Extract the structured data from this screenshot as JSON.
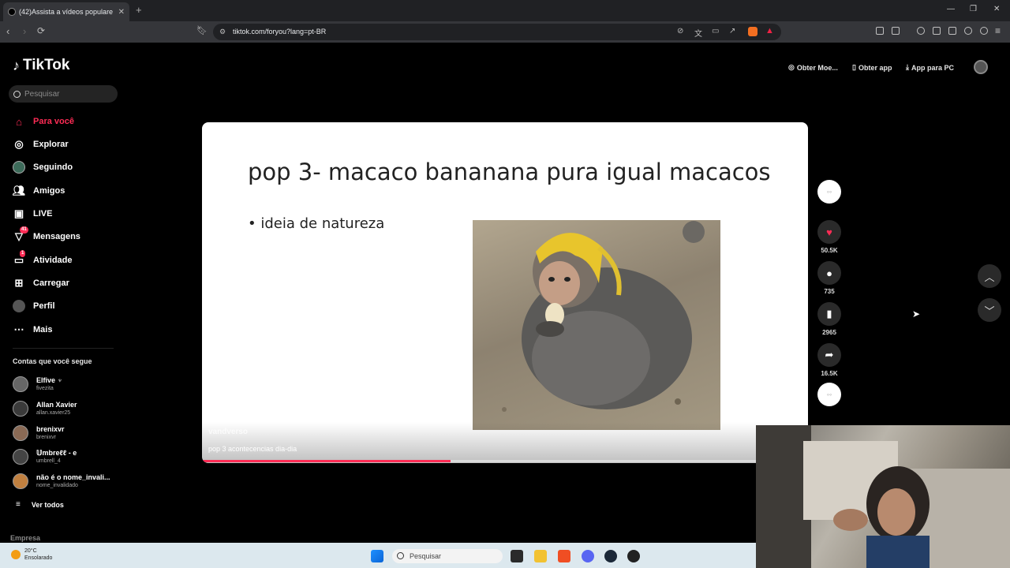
{
  "browser": {
    "tab_title": "(42)Assista a vídeos populare",
    "tab_close": "✕",
    "new_tab": "+",
    "url": "tiktok.com/foryou?lang=pt-BR"
  },
  "sidebar": {
    "logo": "TikTok",
    "search_placeholder": "Pesquisar",
    "items": [
      {
        "label": "Para você",
        "icon": "home-icon"
      },
      {
        "label": "Explorar",
        "icon": "compass-icon"
      },
      {
        "label": "Seguindo",
        "icon": "following-avatar-icon"
      },
      {
        "label": "Amigos",
        "icon": "friends-icon"
      },
      {
        "label": "LIVE",
        "icon": "live-icon"
      },
      {
        "label": "Mensagens",
        "icon": "messages-icon",
        "badge": "41"
      },
      {
        "label": "Atividade",
        "icon": "activity-icon",
        "badge": "1"
      },
      {
        "label": "Carregar",
        "icon": "upload-icon"
      },
      {
        "label": "Perfil",
        "icon": "profile-icon"
      },
      {
        "label": "Mais",
        "icon": "more-icon"
      }
    ],
    "following_title": "Contas que você segue",
    "following": [
      {
        "name": "Elfive ♆",
        "handle": "fivezita"
      },
      {
        "name": "Allan Xavier",
        "handle": "allan.xavier25"
      },
      {
        "name": "brenixvr",
        "handle": "brenixvr"
      },
      {
        "name": "𝕌mbreℓℓ - e",
        "handle": "umbrell_4"
      },
      {
        "name": "não é o nome_invali...",
        "handle": "nome_invalidado"
      }
    ],
    "see_all": "Ver todos",
    "company": "Empresa"
  },
  "topbar": {
    "coins": "Obter Moe...",
    "get_app": "Obter app",
    "pc_app": "App para PC"
  },
  "video": {
    "slide_title": "pop 3- macaco bananana pura igual macacos",
    "bullet": "• ideia de natureza",
    "author": "vandverso",
    "caption": "pop 3 acontecencias dia-dia",
    "progress": 0.41
  },
  "actions": {
    "likes": "50.5K",
    "comments": "735",
    "saves": "2965",
    "shares": "16.5K"
  },
  "taskbar": {
    "temp": "20°C",
    "weather": "Ensolarado",
    "search": "Pesquisar"
  },
  "colors": {
    "accent": "#fe2c55",
    "background": "#000000",
    "slide": "#ffffff"
  }
}
